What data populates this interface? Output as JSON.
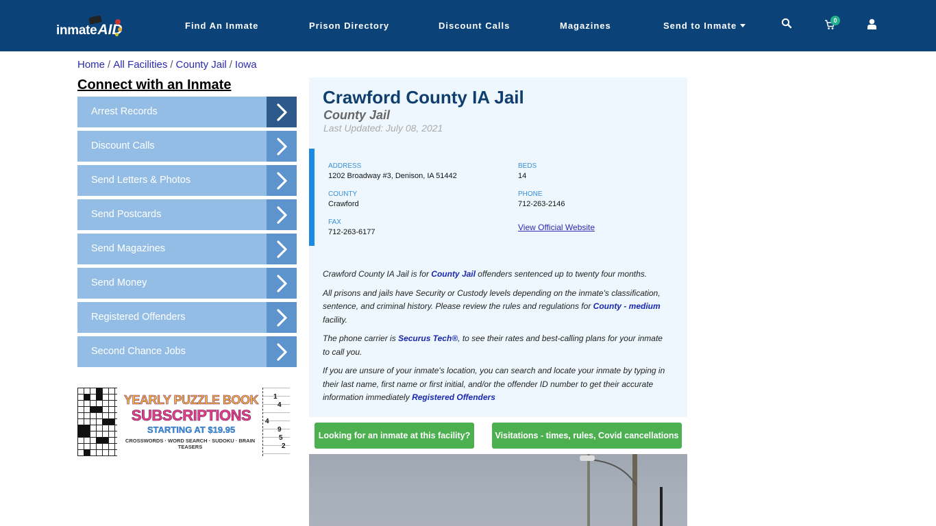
{
  "header": {
    "logo_text_1": "inmate",
    "logo_text_2": "AID",
    "nav": [
      {
        "label": "Find An Inmate"
      },
      {
        "label": "Prison Directory"
      },
      {
        "label": "Discount Calls"
      },
      {
        "label": "Magazines"
      },
      {
        "label": "Send to Inmate"
      }
    ],
    "icons": {
      "search": "search-icon",
      "cart": "cart-icon",
      "user": "user-icon"
    },
    "cart_count": "0"
  },
  "breadcrumb": [
    {
      "label": "Home"
    },
    {
      "label": "All Facilities"
    },
    {
      "label": "County Jail"
    },
    {
      "label": "Iowa"
    }
  ],
  "breadcrumb_separator": "/",
  "sidebar": {
    "title": "Connect with an Inmate",
    "items": [
      {
        "label": "Arrest Records"
      },
      {
        "label": "Discount Calls"
      },
      {
        "label": "Send Letters & Photos"
      },
      {
        "label": "Send Postcards"
      },
      {
        "label": "Send Magazines"
      },
      {
        "label": "Send Money"
      },
      {
        "label": "Registered Offenders"
      },
      {
        "label": "Second Chance Jobs"
      }
    ],
    "ad": {
      "line1": "YEARLY PUZZLE BOOK",
      "line2": "SUBSCRIPTIONS",
      "line3": "STARTING AT $19.95",
      "line4": "CROSSWORDS · WORD SEARCH · SUDOKU · BRAIN TEASERS",
      "sudoku_digits": [
        "1",
        "4",
        "4",
        "9",
        "5",
        "2"
      ]
    }
  },
  "facility": {
    "name": "Crawford County IA Jail",
    "type": "County Jail",
    "last_updated": "Last Updated: July 08, 2021",
    "fields": {
      "address_label": "ADDRESS",
      "address": "1202 Broadway #3, Denison, IA 51442",
      "beds_label": "BEDS",
      "beds": "14",
      "county_label": "COUNTY",
      "county": "Crawford",
      "phone_label": "PHONE",
      "phone": "712-263-2146",
      "fax_label": "FAX",
      "fax": "712-263-6177",
      "website_link": "View Official Website"
    },
    "description": {
      "p1_a": "Crawford County IA Jail is for ",
      "p1_link": "County Jail",
      "p1_b": " offenders sentenced up to twenty four months.",
      "p2_a": "All prisons and jails have Security or Custody levels depending on the inmate's classification, sentence, and criminal history. Please review the rules and regulations for ",
      "p2_link": "County - medium",
      "p2_b": " facility.",
      "p3_a": "The phone carrier is ",
      "p3_link": "Securus Tech®",
      "p3_b": ", to see their rates and best-calling plans for your inmate to call you.",
      "p4_a": "If you are unsure of your inmate's location, you can search and locate your inmate by typing in their last name, first name or first initial, and/or the offender ID number to get their accurate information immediately ",
      "p4_link": "Registered Offenders"
    }
  },
  "actions": {
    "find_inmate_button": "Looking for an inmate at this facility?",
    "visitation_button": "Visitations - times, rules, Covid cancellations"
  },
  "colors": {
    "nav_bg": "#0b4278",
    "sidebar_item": "#94bde6",
    "sidebar_arrow": "#5d94cd",
    "sidebar_arrow_active": "#2d5a8a",
    "card_bg": "#edf7fd",
    "accent_blue": "#1e88e5",
    "green_button": "#4caf50",
    "badge": "#25b090"
  }
}
